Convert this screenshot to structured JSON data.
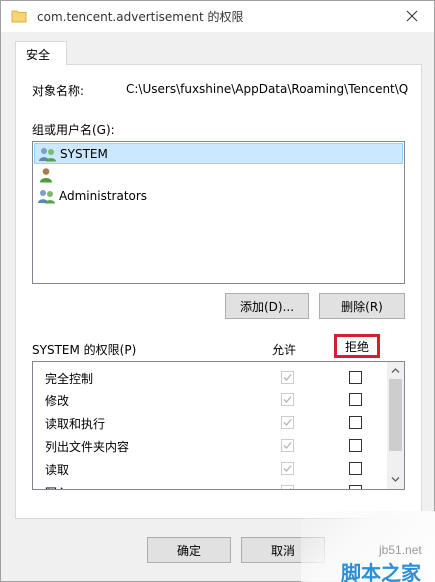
{
  "window": {
    "title": "com.tencent.advertisement 的权限"
  },
  "tabs": [
    {
      "label": "安全"
    }
  ],
  "object": {
    "label": "对象名称:",
    "path": "C:\\Users\\fuxshine\\AppData\\Roaming\\Tencent\\Q"
  },
  "groups": {
    "label": "组或用户名(G):",
    "users": [
      {
        "name": "SYSTEM",
        "icon": "user-group-icon",
        "selected": true
      },
      {
        "name": "",
        "icon": "user-icon",
        "selected": false
      },
      {
        "name": "Administrators",
        "icon": "user-group-icon",
        "selected": false
      }
    ],
    "add_label": "添加(D)...",
    "remove_label": "删除(R)"
  },
  "permissions": {
    "title": "SYSTEM 的权限(P)",
    "allow_header": "允许",
    "deny_header": "拒绝",
    "deny_highlight_color": "#d3202a",
    "rows": [
      {
        "name": "完全控制",
        "allow": true,
        "deny": false
      },
      {
        "name": "修改",
        "allow": true,
        "deny": false
      },
      {
        "name": "读取和执行",
        "allow": true,
        "deny": false
      },
      {
        "name": "列出文件夹内容",
        "allow": true,
        "deny": false
      },
      {
        "name": "读取",
        "allow": true,
        "deny": false
      },
      {
        "name": "写入",
        "allow": true,
        "deny": false
      }
    ]
  },
  "footer": {
    "ok_label": "确定",
    "cancel_label": "取消"
  },
  "watermark": {
    "url": "jb51.net",
    "name": "脚本之家"
  }
}
